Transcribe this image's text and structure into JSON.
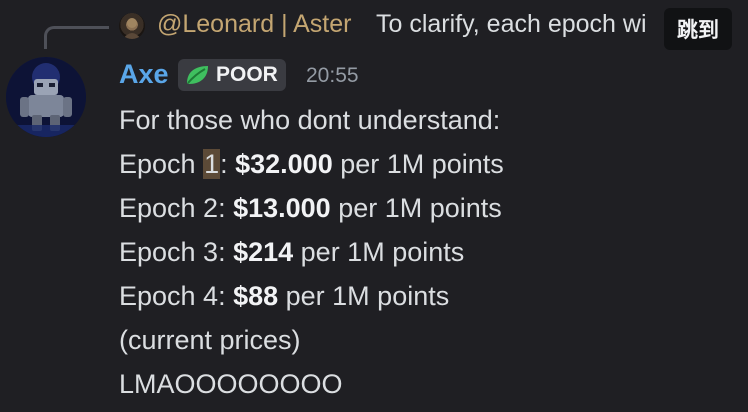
{
  "reply": {
    "author": "@Leonard | Aster",
    "preview": "To clarify, each epoch wi",
    "jump_label": "跳到"
  },
  "message": {
    "username": "Axe",
    "role": "POOR",
    "timestamp": "20:55",
    "intro": "For those who dont understand:",
    "epochs": [
      {
        "prefix": "Epoch ",
        "num": "1",
        "sep": ": ",
        "price": "$32.000",
        "suffix": " per 1M points"
      },
      {
        "prefix": "Epoch 2: ",
        "price": "$13.000",
        "suffix": " per 1M points"
      },
      {
        "prefix": "Epoch 3: ",
        "price": "$214",
        "suffix": " per 1M points"
      },
      {
        "prefix": "Epoch 4: ",
        "price": "$88",
        "suffix": " per 1M points"
      }
    ],
    "note": "(current prices)",
    "closing": "LMAOOOOOOOO"
  },
  "colors": {
    "background": "#1f1f23",
    "username": "#5aa6e8",
    "reply_author": "#c4a672",
    "role_icon": "#3fbf5f"
  },
  "icons": {
    "role": "leaf-icon",
    "avatar": "robot-avatar"
  }
}
